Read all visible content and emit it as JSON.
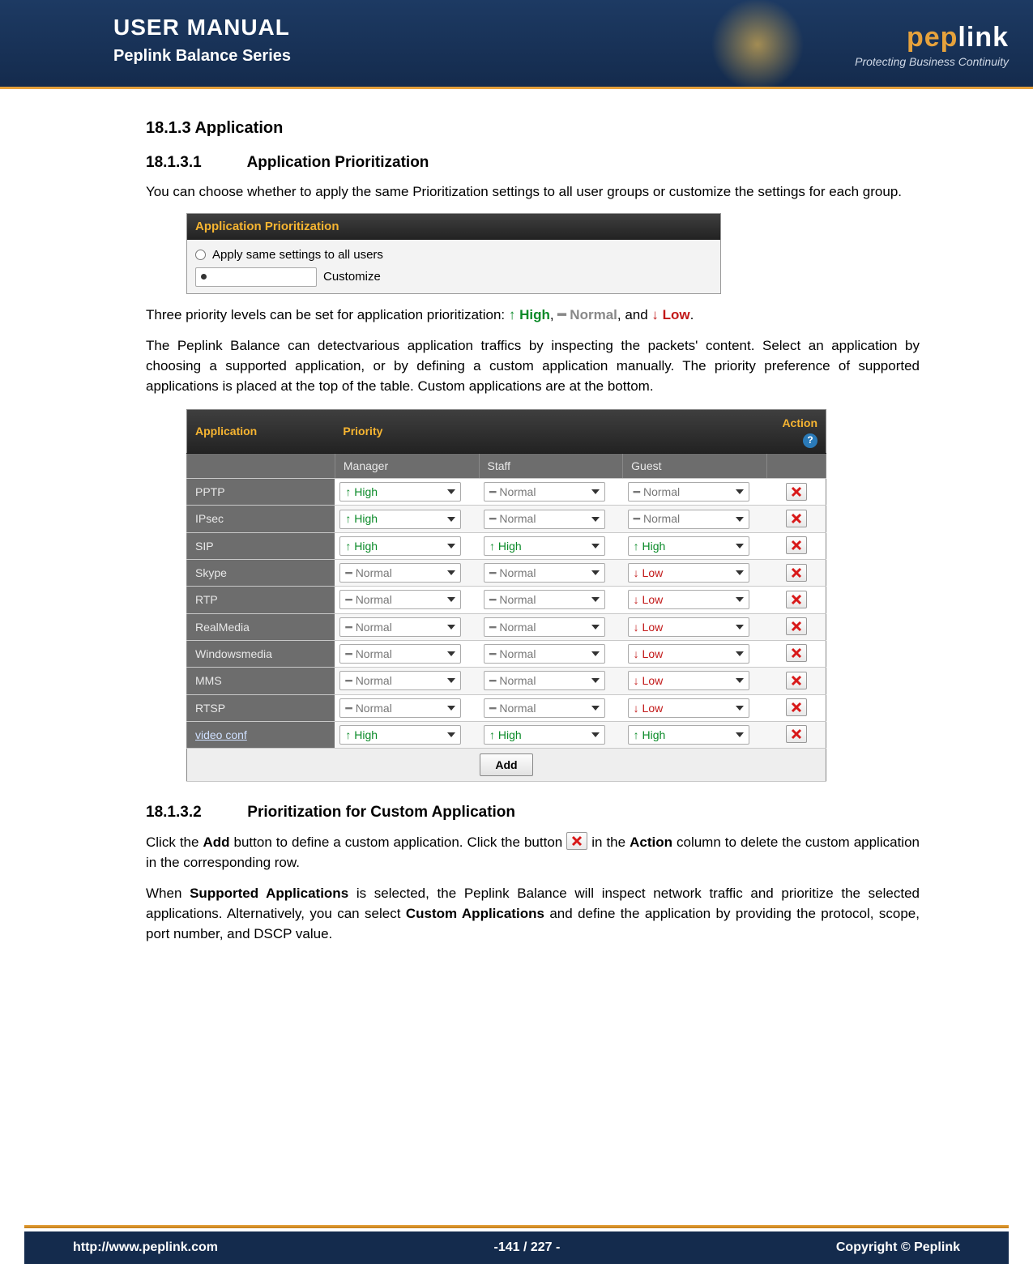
{
  "header": {
    "title": "USER MANUAL",
    "subtitle": "Peplink Balance Series",
    "brand_prefix": "pep",
    "brand_suffix": "link",
    "tagline": "Protecting Business Continuity"
  },
  "section": {
    "num": "18.1.3",
    "title": "Application",
    "sub1_num": "18.1.3.1",
    "sub1_title": "Application Prioritization",
    "p1": "You can choose whether to apply the same Prioritization settings to all user groups or customize the settings for each group.",
    "panel_title": "Application Prioritization",
    "opt_same": "Apply same settings to all users",
    "opt_cust": "Customize",
    "p2_a": "Three priority levels can be set for application prioritization: ",
    "hi": "↑ High",
    "no": "━ Normal",
    "lo": "↓ Low",
    "p2_b": ", ",
    "p2_c": ", and ",
    "p2_d": ".",
    "p3": "The Peplink Balance can detectvarious application traffics by inspecting the packets' content. Select an application by choosing a supported application, or by defining a custom application manually. The priority preference of supported applications is placed at the top of the table. Custom applications are at the bottom.",
    "tbl": {
      "h_app": "Application",
      "h_pri": "Priority",
      "h_act": "Action",
      "cols": [
        "Manager",
        "Staff",
        "Guest"
      ],
      "add": "Add",
      "rows": [
        {
          "app": "PPTP",
          "link": false,
          "p": [
            "↑ High",
            "━ Normal",
            "━ Normal"
          ],
          "cls": [
            "h",
            "n",
            "n"
          ]
        },
        {
          "app": "IPsec",
          "link": false,
          "p": [
            "↑ High",
            "━ Normal",
            "━ Normal"
          ],
          "cls": [
            "h",
            "n",
            "n"
          ]
        },
        {
          "app": "SIP",
          "link": false,
          "p": [
            "↑ High",
            "↑ High",
            "↑ High"
          ],
          "cls": [
            "h",
            "h",
            "h"
          ]
        },
        {
          "app": "Skype",
          "link": false,
          "p": [
            "━ Normal",
            "━ Normal",
            "↓ Low"
          ],
          "cls": [
            "n",
            "n",
            "l"
          ]
        },
        {
          "app": "RTP",
          "link": false,
          "p": [
            "━ Normal",
            "━ Normal",
            "↓ Low"
          ],
          "cls": [
            "n",
            "n",
            "l"
          ]
        },
        {
          "app": "RealMedia",
          "link": false,
          "p": [
            "━ Normal",
            "━ Normal",
            "↓ Low"
          ],
          "cls": [
            "n",
            "n",
            "l"
          ]
        },
        {
          "app": "Windowsmedia",
          "link": false,
          "p": [
            "━ Normal",
            "━ Normal",
            "↓ Low"
          ],
          "cls": [
            "n",
            "n",
            "l"
          ]
        },
        {
          "app": "MMS",
          "link": false,
          "p": [
            "━ Normal",
            "━ Normal",
            "↓ Low"
          ],
          "cls": [
            "n",
            "n",
            "l"
          ]
        },
        {
          "app": "RTSP",
          "link": false,
          "p": [
            "━ Normal",
            "━ Normal",
            "↓ Low"
          ],
          "cls": [
            "n",
            "n",
            "l"
          ]
        },
        {
          "app": "video conf",
          "link": true,
          "p": [
            "↑ High",
            "↑ High",
            "↑ High"
          ],
          "cls": [
            "h",
            "h",
            "h"
          ]
        }
      ]
    },
    "sub2_num": "18.1.3.2",
    "sub2_title": "Prioritization for Custom Application",
    "p4_a": "Click the ",
    "p4_add": "Add",
    "p4_b": " button to define a custom application. Click the button ",
    "p4_c": " in the ",
    "p4_act": "Action",
    "p4_d": " column to delete the custom application in the corresponding row.",
    "p5_a": "When ",
    "p5_sa": "Supported Applications",
    "p5_b": " is selected, the Peplink Balance will inspect network traffic and prioritize the selected applications. Alternatively, you can select ",
    "p5_ca": "Custom Applications",
    "p5_c": "and define the application by providing the protocol, scope, port number, and DSCP value."
  },
  "footer": {
    "url": "http://www.peplink.com",
    "page": "-141 / 227 -",
    "copy": "Copyright ©  Peplink"
  }
}
